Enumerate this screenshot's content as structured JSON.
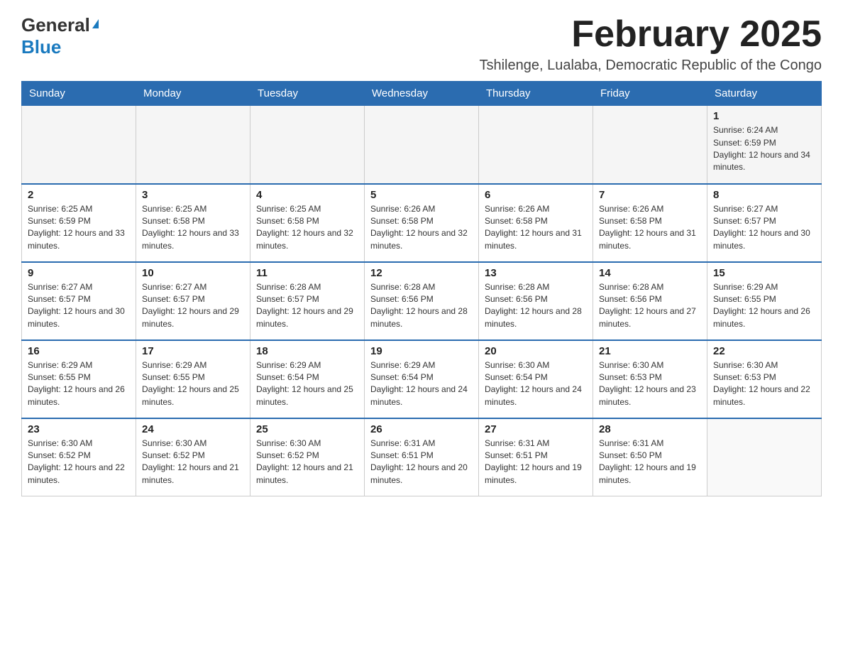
{
  "header": {
    "logo_general": "General",
    "logo_blue": "Blue",
    "month_title": "February 2025",
    "location": "Tshilenge, Lualaba, Democratic Republic of the Congo"
  },
  "days_of_week": [
    "Sunday",
    "Monday",
    "Tuesday",
    "Wednesday",
    "Thursday",
    "Friday",
    "Saturday"
  ],
  "weeks": [
    [
      {
        "num": "",
        "info": ""
      },
      {
        "num": "",
        "info": ""
      },
      {
        "num": "",
        "info": ""
      },
      {
        "num": "",
        "info": ""
      },
      {
        "num": "",
        "info": ""
      },
      {
        "num": "",
        "info": ""
      },
      {
        "num": "1",
        "info": "Sunrise: 6:24 AM\nSunset: 6:59 PM\nDaylight: 12 hours and 34 minutes."
      }
    ],
    [
      {
        "num": "2",
        "info": "Sunrise: 6:25 AM\nSunset: 6:59 PM\nDaylight: 12 hours and 33 minutes."
      },
      {
        "num": "3",
        "info": "Sunrise: 6:25 AM\nSunset: 6:58 PM\nDaylight: 12 hours and 33 minutes."
      },
      {
        "num": "4",
        "info": "Sunrise: 6:25 AM\nSunset: 6:58 PM\nDaylight: 12 hours and 32 minutes."
      },
      {
        "num": "5",
        "info": "Sunrise: 6:26 AM\nSunset: 6:58 PM\nDaylight: 12 hours and 32 minutes."
      },
      {
        "num": "6",
        "info": "Sunrise: 6:26 AM\nSunset: 6:58 PM\nDaylight: 12 hours and 31 minutes."
      },
      {
        "num": "7",
        "info": "Sunrise: 6:26 AM\nSunset: 6:58 PM\nDaylight: 12 hours and 31 minutes."
      },
      {
        "num": "8",
        "info": "Sunrise: 6:27 AM\nSunset: 6:57 PM\nDaylight: 12 hours and 30 minutes."
      }
    ],
    [
      {
        "num": "9",
        "info": "Sunrise: 6:27 AM\nSunset: 6:57 PM\nDaylight: 12 hours and 30 minutes."
      },
      {
        "num": "10",
        "info": "Sunrise: 6:27 AM\nSunset: 6:57 PM\nDaylight: 12 hours and 29 minutes."
      },
      {
        "num": "11",
        "info": "Sunrise: 6:28 AM\nSunset: 6:57 PM\nDaylight: 12 hours and 29 minutes."
      },
      {
        "num": "12",
        "info": "Sunrise: 6:28 AM\nSunset: 6:56 PM\nDaylight: 12 hours and 28 minutes."
      },
      {
        "num": "13",
        "info": "Sunrise: 6:28 AM\nSunset: 6:56 PM\nDaylight: 12 hours and 28 minutes."
      },
      {
        "num": "14",
        "info": "Sunrise: 6:28 AM\nSunset: 6:56 PM\nDaylight: 12 hours and 27 minutes."
      },
      {
        "num": "15",
        "info": "Sunrise: 6:29 AM\nSunset: 6:55 PM\nDaylight: 12 hours and 26 minutes."
      }
    ],
    [
      {
        "num": "16",
        "info": "Sunrise: 6:29 AM\nSunset: 6:55 PM\nDaylight: 12 hours and 26 minutes."
      },
      {
        "num": "17",
        "info": "Sunrise: 6:29 AM\nSunset: 6:55 PM\nDaylight: 12 hours and 25 minutes."
      },
      {
        "num": "18",
        "info": "Sunrise: 6:29 AM\nSunset: 6:54 PM\nDaylight: 12 hours and 25 minutes."
      },
      {
        "num": "19",
        "info": "Sunrise: 6:29 AM\nSunset: 6:54 PM\nDaylight: 12 hours and 24 minutes."
      },
      {
        "num": "20",
        "info": "Sunrise: 6:30 AM\nSunset: 6:54 PM\nDaylight: 12 hours and 24 minutes."
      },
      {
        "num": "21",
        "info": "Sunrise: 6:30 AM\nSunset: 6:53 PM\nDaylight: 12 hours and 23 minutes."
      },
      {
        "num": "22",
        "info": "Sunrise: 6:30 AM\nSunset: 6:53 PM\nDaylight: 12 hours and 22 minutes."
      }
    ],
    [
      {
        "num": "23",
        "info": "Sunrise: 6:30 AM\nSunset: 6:52 PM\nDaylight: 12 hours and 22 minutes."
      },
      {
        "num": "24",
        "info": "Sunrise: 6:30 AM\nSunset: 6:52 PM\nDaylight: 12 hours and 21 minutes."
      },
      {
        "num": "25",
        "info": "Sunrise: 6:30 AM\nSunset: 6:52 PM\nDaylight: 12 hours and 21 minutes."
      },
      {
        "num": "26",
        "info": "Sunrise: 6:31 AM\nSunset: 6:51 PM\nDaylight: 12 hours and 20 minutes."
      },
      {
        "num": "27",
        "info": "Sunrise: 6:31 AM\nSunset: 6:51 PM\nDaylight: 12 hours and 19 minutes."
      },
      {
        "num": "28",
        "info": "Sunrise: 6:31 AM\nSunset: 6:50 PM\nDaylight: 12 hours and 19 minutes."
      },
      {
        "num": "",
        "info": ""
      }
    ]
  ]
}
